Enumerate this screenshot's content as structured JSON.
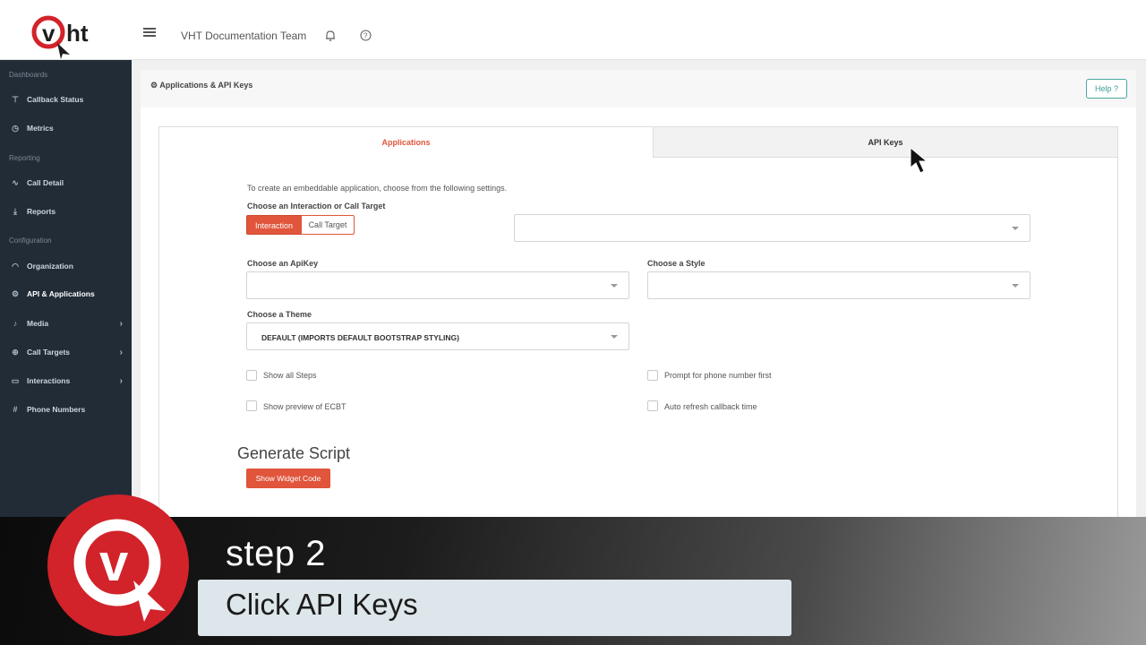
{
  "header": {
    "logo_text": "vht",
    "team_name": "VHT Documentation Team"
  },
  "sidebar": {
    "sections": [
      {
        "label": "Dashboards"
      },
      {
        "label": "Reporting"
      },
      {
        "label": "Configuration"
      }
    ],
    "items": [
      {
        "label": "Callback Status",
        "icon": "antenna-icon"
      },
      {
        "label": "Metrics",
        "icon": "clock-icon"
      },
      {
        "label": "Call Detail",
        "icon": "pulse-icon"
      },
      {
        "label": "Reports",
        "icon": "download-icon"
      },
      {
        "label": "Organization",
        "icon": "headset-icon"
      },
      {
        "label": "API & Applications",
        "icon": "gear-icon",
        "active": true
      },
      {
        "label": "Media",
        "icon": "microphone-icon",
        "has_children": true
      },
      {
        "label": "Call Targets",
        "icon": "crosshair-icon",
        "has_children": true
      },
      {
        "label": "Interactions",
        "icon": "chat-icon",
        "has_children": true
      },
      {
        "label": "Phone Numbers",
        "icon": "hash-icon"
      }
    ]
  },
  "page": {
    "title": "Applications & API Keys",
    "help_label": "Help"
  },
  "tabs": [
    {
      "label": "Applications",
      "active": true
    },
    {
      "label": "API Keys",
      "active": false
    }
  ],
  "form": {
    "instructions": "To create an embeddable application, choose from the following settings.",
    "target_label": "Choose an Interaction or Call Target",
    "target_options": [
      "Interaction",
      "Call Target"
    ],
    "target_selected": "Interaction",
    "target_select_value": "",
    "apikey_label": "Choose an ApiKey",
    "apikey_value": "",
    "style_label": "Choose a Style",
    "style_value": "",
    "theme_label": "Choose a Theme",
    "theme_value": "DEFAULT (IMPORTS DEFAULT BOOTSTRAP STYLING)",
    "checkboxes": [
      {
        "label": "Show all Steps",
        "checked": false
      },
      {
        "label": "Prompt for phone number first",
        "checked": false
      },
      {
        "label": "Show preview of ECBT",
        "checked": false
      },
      {
        "label": "Auto refresh callback time",
        "checked": false
      }
    ],
    "generate_title": "Generate Script",
    "widget_button": "Show Widget Code"
  },
  "overlay": {
    "step": "step 2",
    "instruction": "Click API Keys"
  },
  "colors": {
    "accent": "#e0553b",
    "sidebar": "#222c37",
    "help": "#3e9e95",
    "brand_red": "#d2232a"
  }
}
